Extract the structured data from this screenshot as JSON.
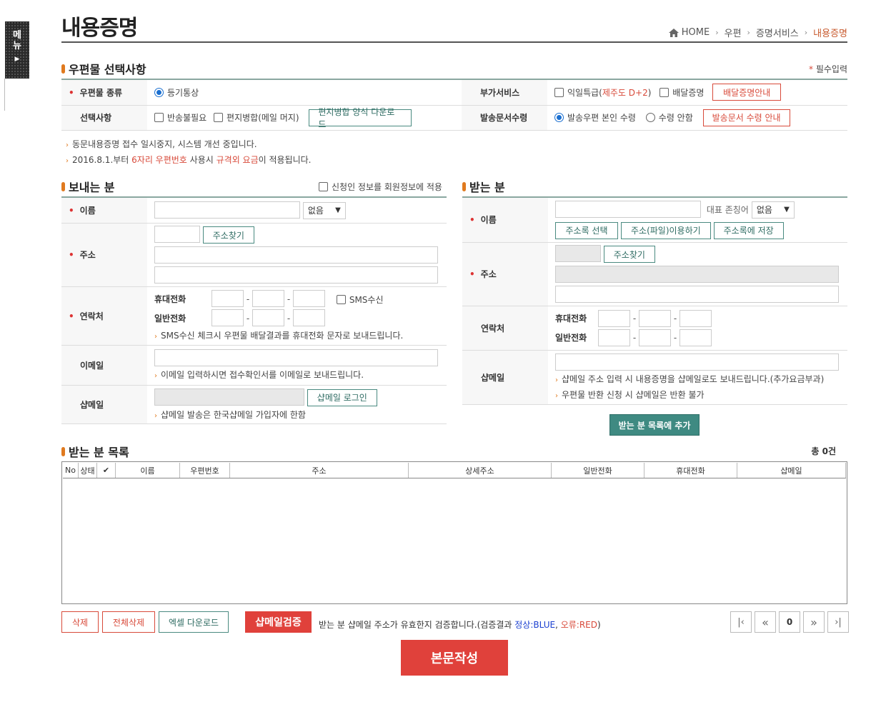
{
  "side_menu": {
    "label": "메뉴"
  },
  "header": {
    "title": "내용증명",
    "breadcrumb": [
      "HOME",
      "우편",
      "증명서비스",
      "내용증명"
    ]
  },
  "mail_options": {
    "title": "우편물 선택사항",
    "required_note": "필수입력",
    "mail_type_label": "우편물 종류",
    "mail_type_value": "등기통상",
    "selection_label": "선택사항",
    "no_return": "반송불필요",
    "letter_merge": "편지병합(메일 머지)",
    "merge_download_btn": "편지병합 양식 다운로드",
    "extra_service_label": "부가서비스",
    "next_day_prefix": "익일특급(",
    "next_day_red": "제주도 D+2",
    "next_day_suffix": ")",
    "delivery_proof": "배달증명",
    "delivery_proof_btn": "배달증명안내",
    "doc_count_label": "발송문서수령",
    "receive_self": "발송우편 본인 수령",
    "receive_none": "수령 안함",
    "doc_receive_btn": "발송문서 수령 안내"
  },
  "notices": {
    "line1": "동문내용증명 접수 일시중지, 시스템 개선 중입니다.",
    "line2_a": "2016.8.1.부터 ",
    "line2_b": "6자리 우편번호",
    "line2_c": " 사용시 ",
    "line2_d": "규격외 요금",
    "line2_e": "이 적용됩니다."
  },
  "sender": {
    "title": "보내는 분",
    "apply_member": "신청인 정보를 회원정보에 적용",
    "name_label": "이름",
    "honorific": "없음",
    "address_label": "주소",
    "find_address_btn": "주소찾기",
    "contact_label": "연락처",
    "mobile_label": "휴대전화",
    "phone_label": "일반전화",
    "sms_label": "SMS수신",
    "sms_note": "SMS수신 체크시 우편물 배달결과를 휴대전화 문자로 보내드립니다.",
    "email_label": "이메일",
    "email_note": "이메일 입력하시면 접수확인서를 이메일로 보내드립니다.",
    "shopmail_label": "샵메일",
    "shopmail_login_btn": "샵메일 로그인",
    "shopmail_note": "샵메일 발송은 한국샵메일 가입자에 한함"
  },
  "receiver": {
    "title": "받는 분",
    "name_label": "이름",
    "honorific_label": "대표 존칭어",
    "honorific": "없음",
    "addr_select_btn": "주소록 선택",
    "addr_file_btn": "주소(파일)이용하기",
    "addr_save_btn": "주소록에 저장",
    "address_label": "주소",
    "find_address_btn": "주소찾기",
    "contact_label": "연락처",
    "mobile_label": "휴대전화",
    "phone_label": "일반전화",
    "shopmail_label": "샵메일",
    "shopmail_note1": "샵메일 주소 입력 시 내용증명을 샵메일로도 보내드립니다.(추가요금부과)",
    "shopmail_note2": "우편물 반환 신청 시 샵메일은 반환 불가",
    "add_btn": "받는 분 목록에 추가"
  },
  "recipient_list": {
    "title": "받는 분 목록",
    "total_prefix": "총",
    "total_count": "0",
    "total_suffix": "건",
    "columns": [
      "No",
      "상태",
      "✔",
      "이름",
      "우편번호",
      "주소",
      "상세주소",
      "일반전화",
      "휴대전화",
      "샵메일"
    ]
  },
  "bottom": {
    "delete_btn": "삭제",
    "delete_all_btn": "전체삭제",
    "excel_btn": "엑셀 다운로드",
    "verify_btn": "샵메일검증",
    "verify_note_a": "받는 분 샵메일 주소가 유효한지 검증합니다.(검증결과 ",
    "verify_ok": "정상:BLUE",
    "verify_sep": ", ",
    "verify_err": "오류:RED",
    "verify_note_b": ")",
    "page_first": "|‹",
    "page_prev": "«",
    "page_num": "0",
    "page_next": "»",
    "page_last": "›|",
    "write_btn": "본문작성"
  },
  "colors": {
    "accent": "#e07a1f",
    "teal": "#4a8a80",
    "red_btn": "#e0413b",
    "breadcrumb_current": "#c85a2e"
  }
}
